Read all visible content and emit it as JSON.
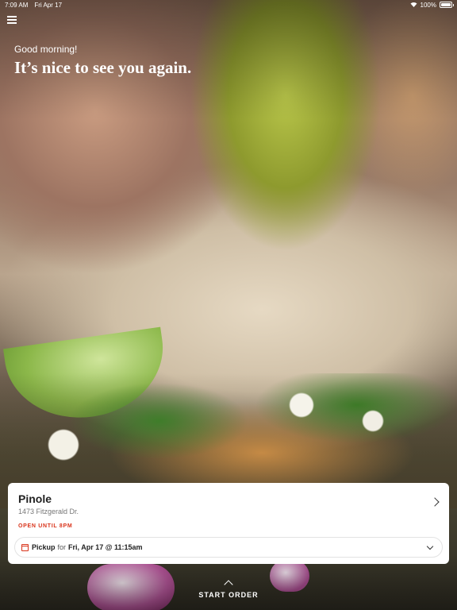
{
  "status_bar": {
    "time": "7:09 AM",
    "date": "Fri Apr 17",
    "battery": "100%"
  },
  "header": {
    "greeting": "Good morning!",
    "welcome": "It’s nice to see you again."
  },
  "location_card": {
    "store_name": "Pinole",
    "address": "1473 Fitzgerald Dr.",
    "hours_status": "OPEN UNTIL 8PM",
    "order_mode": "Pickup",
    "for_text": "for",
    "pickup_time": "Fri, Apr 17 @ 11:15am"
  },
  "start_order": {
    "label": "START ORDER"
  },
  "icons": {
    "menu": "hamburger-icon",
    "wifi": "wifi-icon",
    "battery": "battery-icon",
    "calendar": "calendar-icon"
  },
  "colors": {
    "accent": "#d9341b",
    "card_bg": "#ffffff"
  }
}
